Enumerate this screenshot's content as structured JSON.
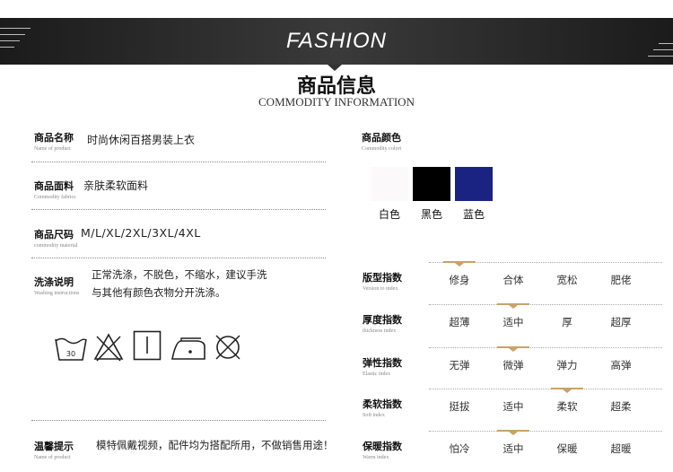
{
  "banner": {
    "title": "FASHION"
  },
  "section": {
    "title": "商品信息",
    "subtitle": "COMMODITY INFORMATION"
  },
  "fields": {
    "name": {
      "label": "商品名称",
      "label_en": "Name of product",
      "value": "时尚休闲百搭男装上衣"
    },
    "fabric": {
      "label": "商品面料",
      "label_en": "Commodity fabrics",
      "value": "亲肤柔软面料"
    },
    "size": {
      "label": "商品尺码",
      "label_en": "commodity material",
      "value": "M/L/XL/2XL/3XL/4XL"
    },
    "wash": {
      "label": "洗涤说明",
      "label_en": "Washing instructions",
      "line1": "正常洗涤，不脱色，不缩水，建议手洗",
      "line2": "与其他有颜色衣物分开洗涤。"
    },
    "tips": {
      "label": "温馨提示",
      "label_en": "Name of product",
      "value": "模特佩戴视频，配件均为搭配所用，不做销售用途！"
    },
    "color": {
      "label": "商品颜色",
      "label_en": "Commodity colort"
    }
  },
  "wash_icons": {
    "temp": "30"
  },
  "colors": [
    {
      "name": "白色",
      "hex": "#fbf9f9"
    },
    {
      "name": "黑色",
      "hex": "#000000"
    },
    {
      "name": "蓝色",
      "hex": "#1a2282"
    }
  ],
  "accent_color": "#c8a26a",
  "indices": [
    {
      "label": "版型指数",
      "label_en": "Version to index",
      "options": [
        "修身",
        "合体",
        "宽松",
        "肥佬"
      ],
      "selected": 0
    },
    {
      "label": "厚度指数",
      "label_en": "thickness index",
      "options": [
        "超薄",
        "适中",
        "厚",
        "超厚"
      ],
      "selected": 1
    },
    {
      "label": "弹性指数",
      "label_en": "Elastic index",
      "options": [
        "无弹",
        "微弹",
        "弹力",
        "高弹"
      ],
      "selected": 1
    },
    {
      "label": "柔软指数",
      "label_en": "Soft index",
      "options": [
        "挺拔",
        "适中",
        "柔软",
        "超柔"
      ],
      "selected": 2
    },
    {
      "label": "保暖指数",
      "label_en": "Warm index",
      "options": [
        "怕冷",
        "适中",
        "保暖",
        "超暖"
      ],
      "selected": 1
    }
  ]
}
